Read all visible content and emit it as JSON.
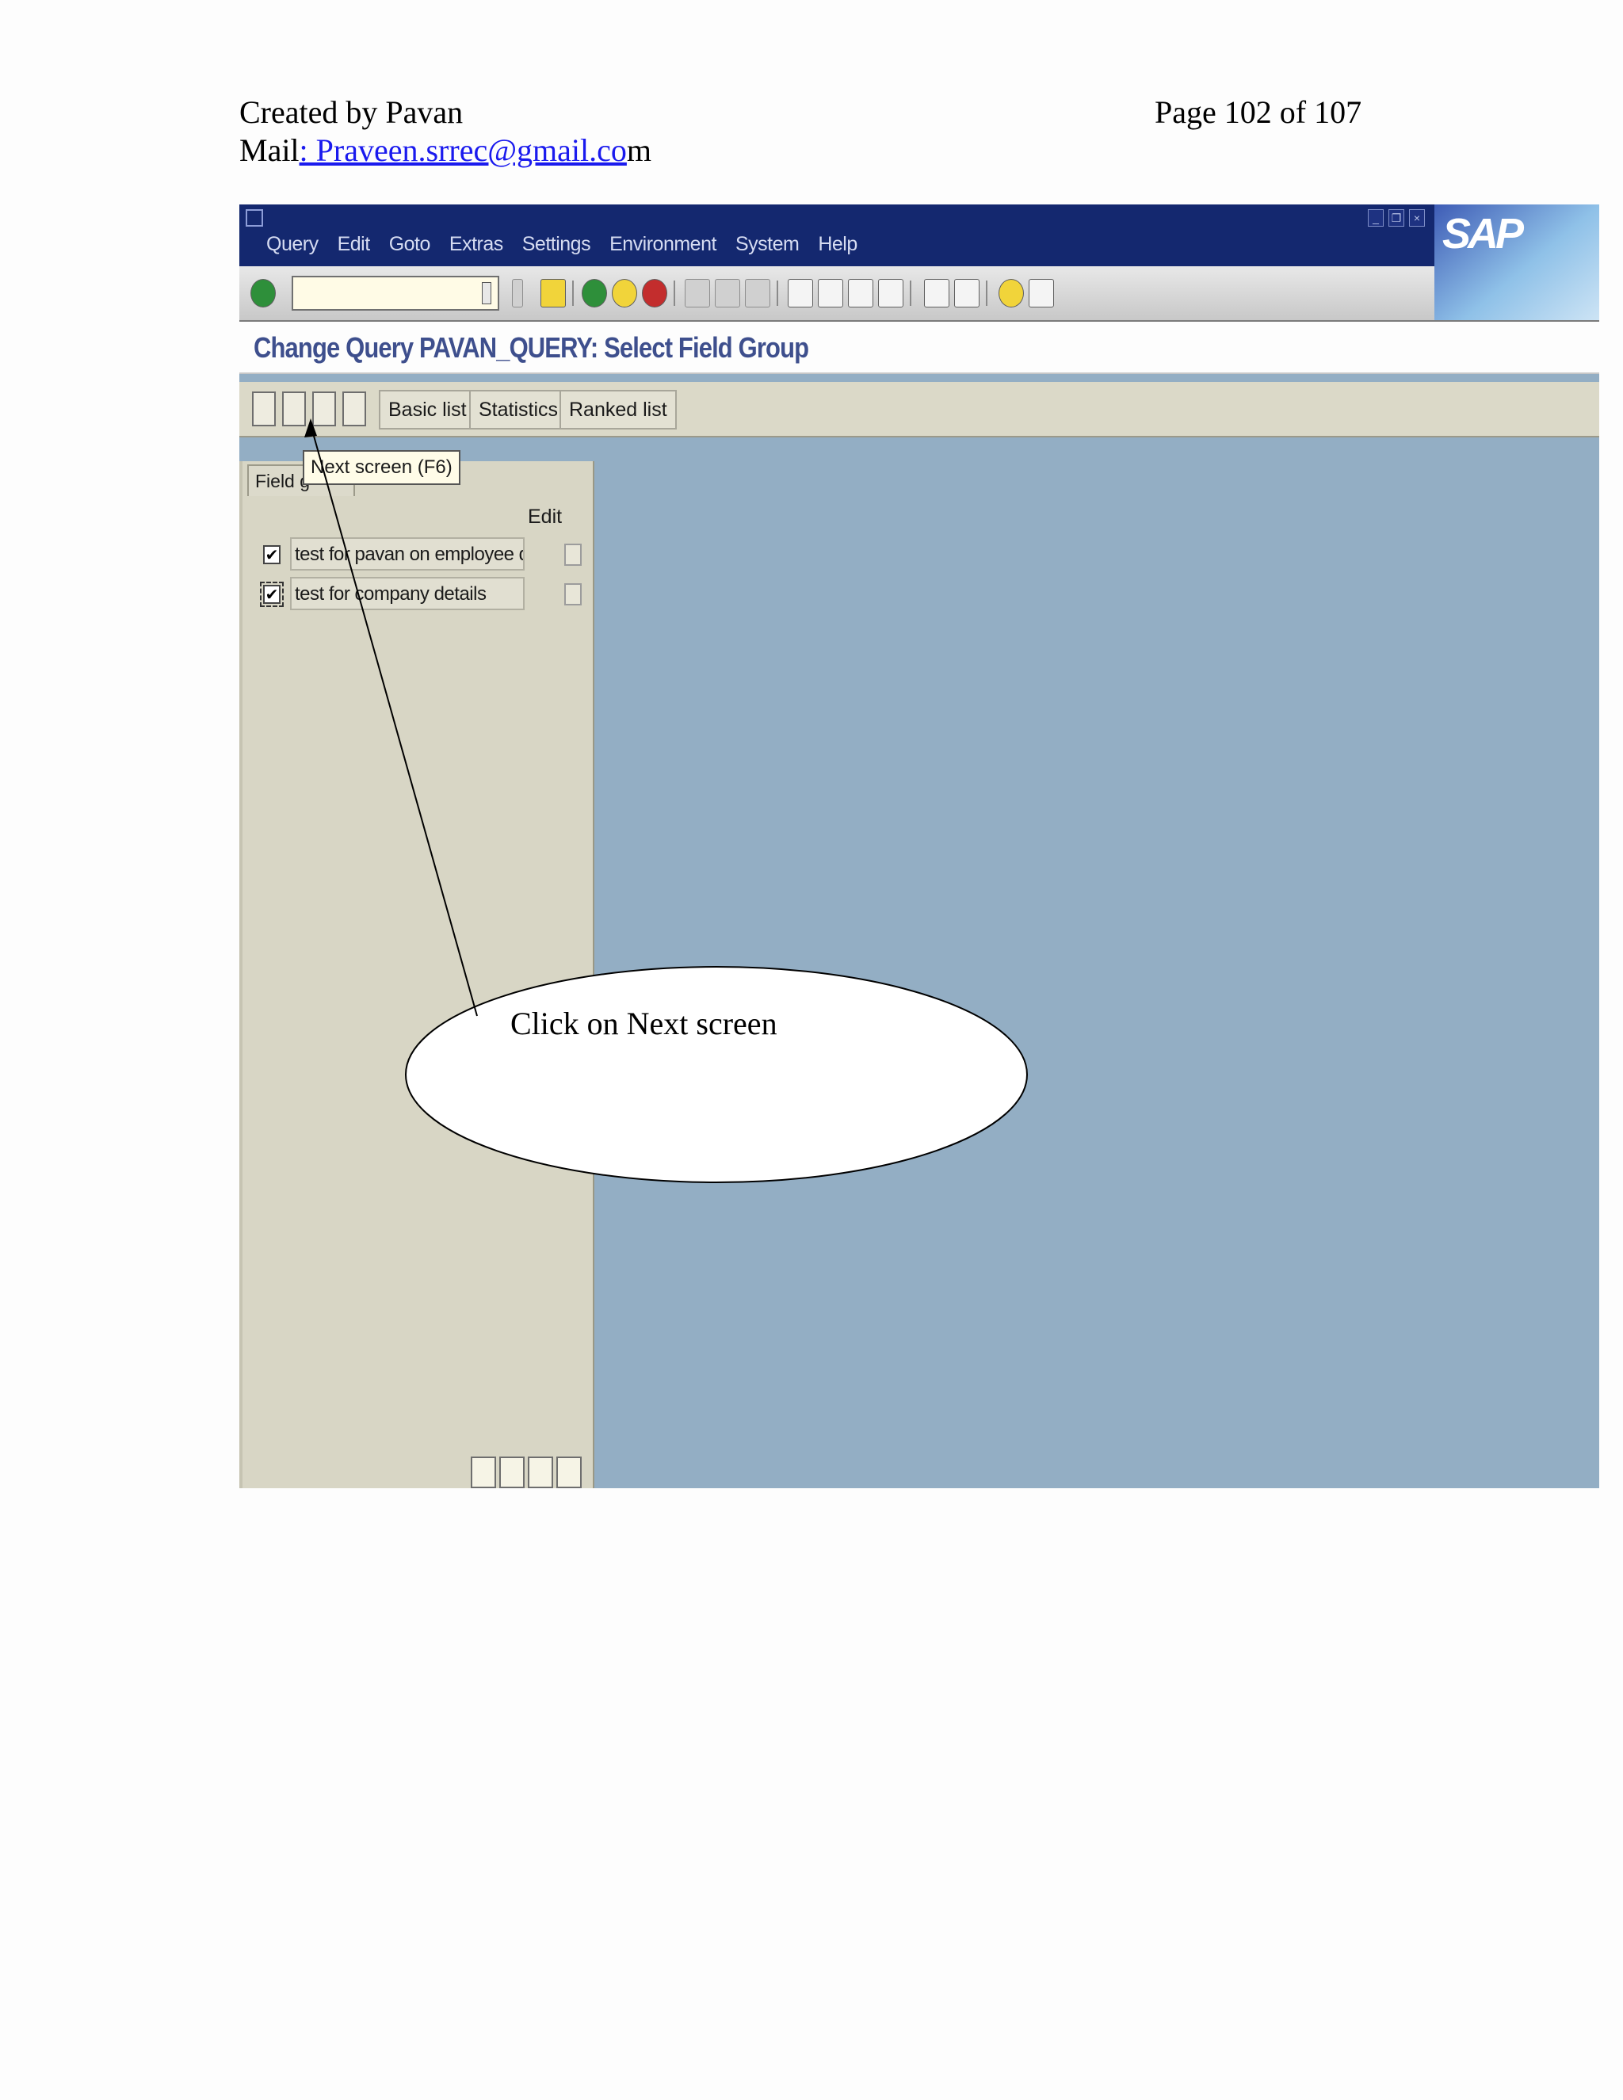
{
  "document_header": {
    "created_by": "Created by  Pavan",
    "page_label": "Page 102 of 107",
    "mail_prefix": "Mail",
    "mail_link": ": Praveen.srrec@gmail.co",
    "mail_suffix": "m"
  },
  "sap_window": {
    "logo_text": "SAP",
    "menu": [
      "Query",
      "Edit",
      "Goto",
      "Extras",
      "Settings",
      "Environment",
      "System",
      "Help"
    ],
    "command_field": {
      "value": "",
      "placeholder": ""
    },
    "page_title": "Change Query PAVAN_QUERY: Select Field Group"
  },
  "app_toolbar": {
    "buttons": [
      "Basic list",
      "Statistics",
      "Ranked list"
    ]
  },
  "tooltip": "Next screen   (F6)",
  "field_groups_panel": {
    "tab_label": "Field g",
    "edit_header": "Edit",
    "rows": [
      {
        "label": "test for pavan on employee d...",
        "checked": "✔"
      },
      {
        "label": "test for company details",
        "checked": "✔"
      }
    ]
  },
  "callout": {
    "text": "Click on Next screen"
  },
  "colors": {
    "titlebar": "#14286f",
    "workspace": "#93aec4",
    "panel": "#d8d6c5",
    "page_title": "#3e4f8d"
  }
}
